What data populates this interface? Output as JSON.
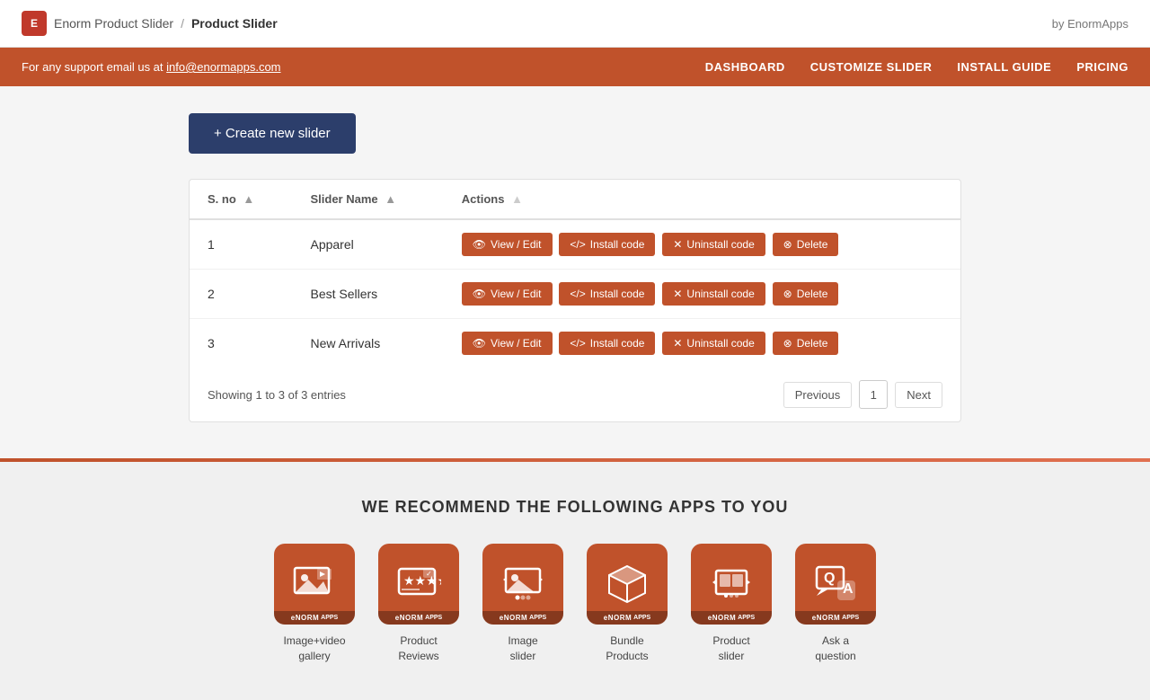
{
  "topbar": {
    "logo_text": "E",
    "app_name": "Enorm Product Slider",
    "separator": "/",
    "product_name": "Product Slider",
    "by_text": "by EnormApps"
  },
  "navbar": {
    "support_text": "For any support email us at ",
    "support_email": "info@enormapps.com",
    "nav_items": [
      {
        "label": "DASHBOARD",
        "id": "nav-dashboard"
      },
      {
        "label": "CUSTOMIZE SLIDER",
        "id": "nav-customize"
      },
      {
        "label": "INSTALL GUIDE",
        "id": "nav-install"
      },
      {
        "label": "PRICING",
        "id": "nav-pricing"
      }
    ]
  },
  "create_button": "+ Create new slider",
  "table": {
    "headers": [
      {
        "label": "S. no",
        "sortable": true
      },
      {
        "label": "Slider Name",
        "sortable": true
      },
      {
        "label": "Actions",
        "sortable": false
      }
    ],
    "rows": [
      {
        "sno": "1",
        "name": "Apparel",
        "actions": [
          "View / Edit",
          "Install code",
          "Uninstall code",
          "Delete"
        ]
      },
      {
        "sno": "2",
        "name": "Best Sellers",
        "actions": [
          "View / Edit",
          "Install code",
          "Uninstall code",
          "Delete"
        ]
      },
      {
        "sno": "3",
        "name": "New Arrivals",
        "actions": [
          "View / Edit",
          "Install code",
          "Uninstall code",
          "Delete"
        ]
      }
    ],
    "action_labels": {
      "view": "View / Edit",
      "install": "Install code",
      "uninstall": "Uninstall code",
      "delete": "Delete"
    }
  },
  "pagination": {
    "showing_text": "Showing 1 to 3 of 3 entries",
    "previous": "Previous",
    "current_page": "1",
    "next": "Next"
  },
  "recommend": {
    "title": "WE RECOMMEND THE FOLLOWING APPS TO YOU",
    "apps": [
      {
        "label": "Image+video\ngallery",
        "icon": "gallery"
      },
      {
        "label": "Product\nReviews",
        "icon": "reviews"
      },
      {
        "label": "Image\nslider",
        "icon": "image-slider"
      },
      {
        "label": "Bundle\nProducts",
        "icon": "bundle"
      },
      {
        "label": "Product\nslider",
        "icon": "product-slider"
      },
      {
        "label": "Ask a\nquestion",
        "icon": "ask-question"
      }
    ]
  }
}
